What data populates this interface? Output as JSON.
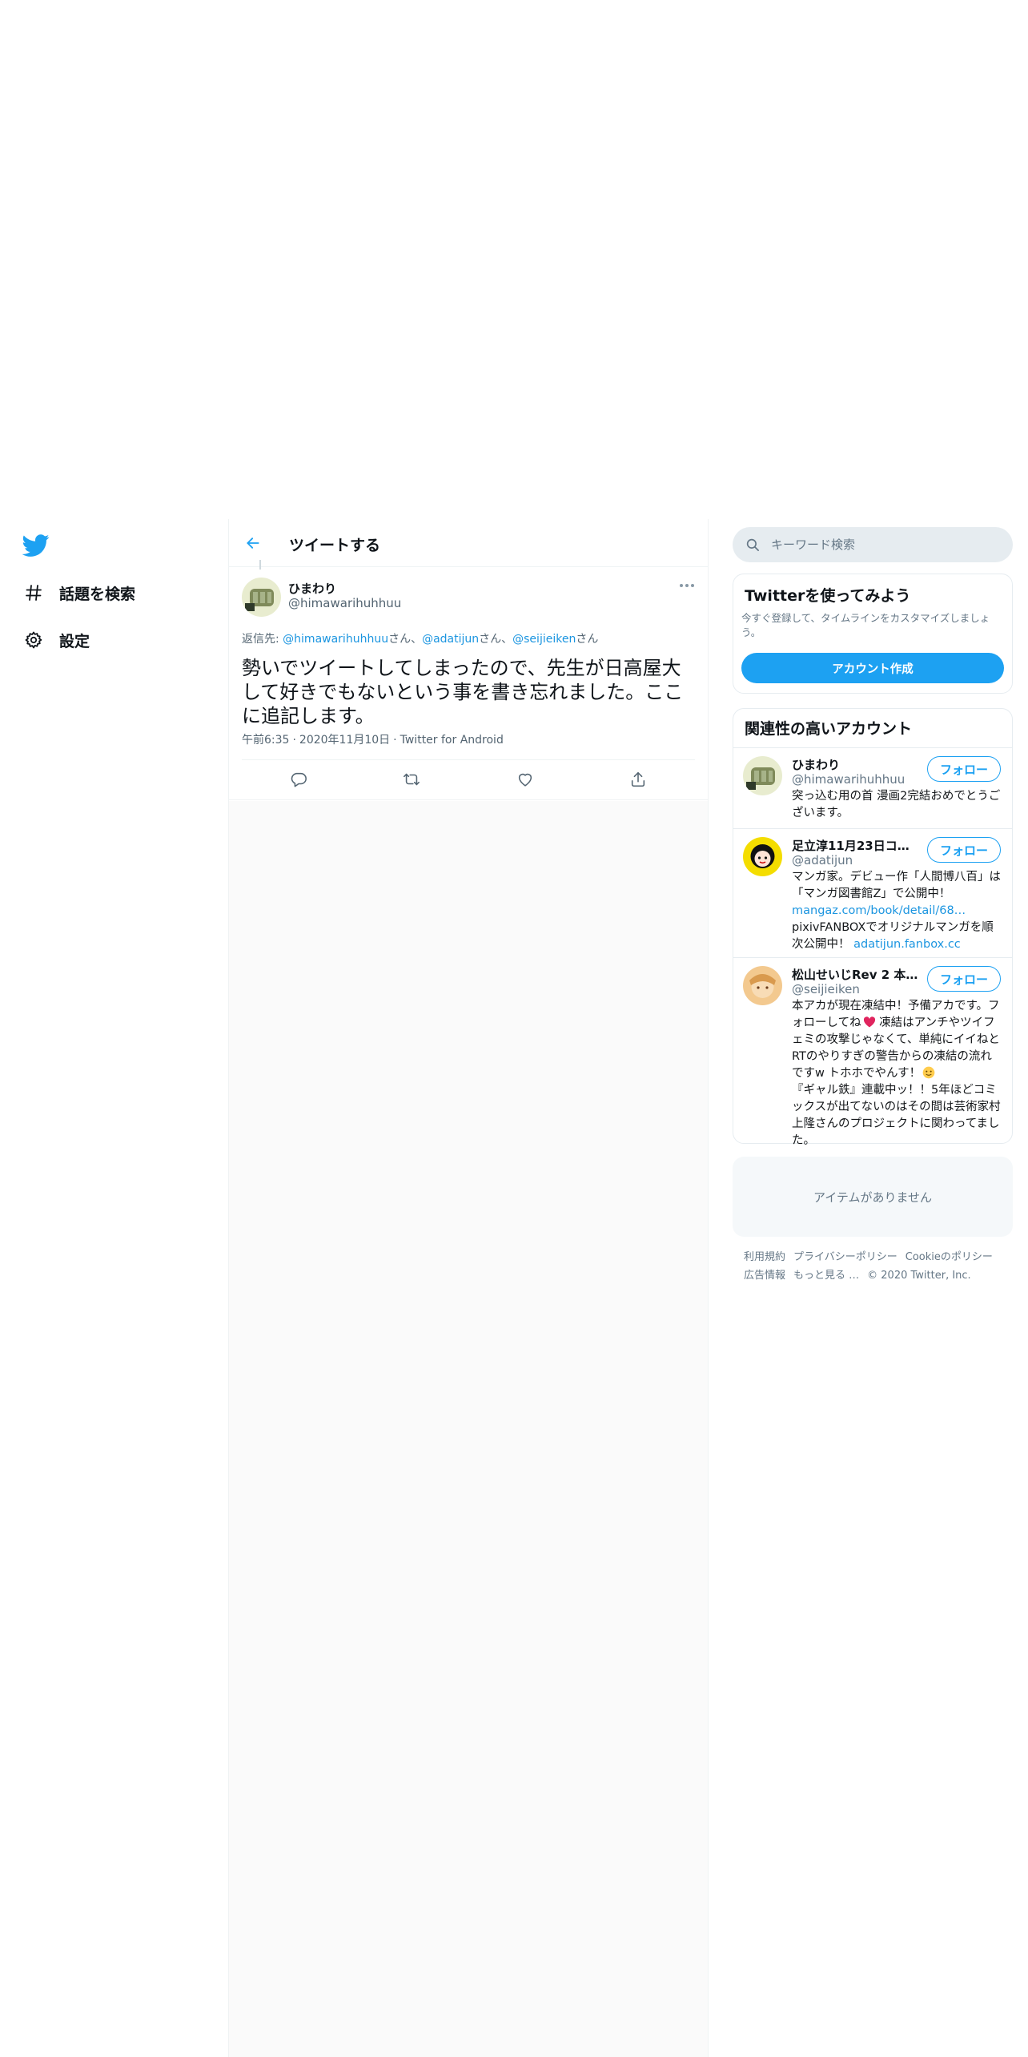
{
  "nav": {
    "logo": "twitter-bird-icon",
    "items": [
      {
        "label": "話題を検索",
        "icon": "hashtag-icon"
      },
      {
        "label": "設定",
        "icon": "gear-icon"
      }
    ]
  },
  "header": {
    "title": "ツイートする"
  },
  "tweet": {
    "name": "ひまわり",
    "handle": "@himawarihuhhuu",
    "reply_prefix": "返信先: ",
    "mentions": [
      {
        "handle": "@himawarihuhhuu",
        "suffix": "さん、"
      },
      {
        "handle": "@adatijun",
        "suffix": "さん、"
      },
      {
        "handle": "@seijieiken",
        "suffix": "さん"
      }
    ],
    "text": "勢いでツイートしてしまったので、先生が日高屋大して好きでもないという事を書き忘れました。ここに追記します。",
    "time": "午前6:35",
    "dot": "·",
    "date": "2020年11月10日",
    "source": "Twitter for Android"
  },
  "search": {
    "placeholder": "キーワード検索"
  },
  "signup": {
    "title": "Twitterを使ってみよう",
    "description": "今すぐ登録して、タイムラインをカスタマイズしましょう。",
    "button": "アカウント作成"
  },
  "related": {
    "title": "関連性の高いアカウント",
    "follow_label": "フォロー",
    "accounts": [
      {
        "name": "ひまわり",
        "handle": "@himawarihuhhuu",
        "bio": "突っ込む用の首 漫画2完結おめでとうございます。"
      },
      {
        "name": "足立淳11月23日コミ…",
        "handle": "@adatijun",
        "bio_text_1": "マンガ家。デビュー作「人間博八百」は「マンガ図書館Z」で公開中！",
        "bio_link_1": "mangaz.com/book/detail/68…",
        "bio_text_2": "pixivFANBOXでオリジナルマンガを順次公開中！ ",
        "bio_link_2": "adatijun.fanbox.cc"
      },
      {
        "name": "松山せいじRev 2 本…",
        "handle": "@seijieiken",
        "bio_1": "本アカが現在凍結中！予備アカです。フォローしてね",
        "bio_2": " 凍結はアンチやツイフェミの攻撃じゃなくて、単純にイイねとRTのやりすぎの警告からの凍結の流れですw トホホでやんす！",
        "bio_3": "『ギャル鉄』連載中ッ！！5年ほどコミックスが出てないのはその間は芸術家村上隆さんのプロジェクトに関わってました。"
      }
    ]
  },
  "trends": {
    "empty": "アイテムがありません"
  },
  "footer": {
    "links": [
      "利用規約",
      "プライバシーポリシー",
      "Cookieのポリシー",
      "広告情報",
      "もっと見る …"
    ],
    "copyright": "© 2020 Twitter, Inc."
  },
  "colors": {
    "accent": "#1da1f2",
    "link": "#1b95e0",
    "muted": "#657786",
    "border": "#e6ecf0"
  }
}
